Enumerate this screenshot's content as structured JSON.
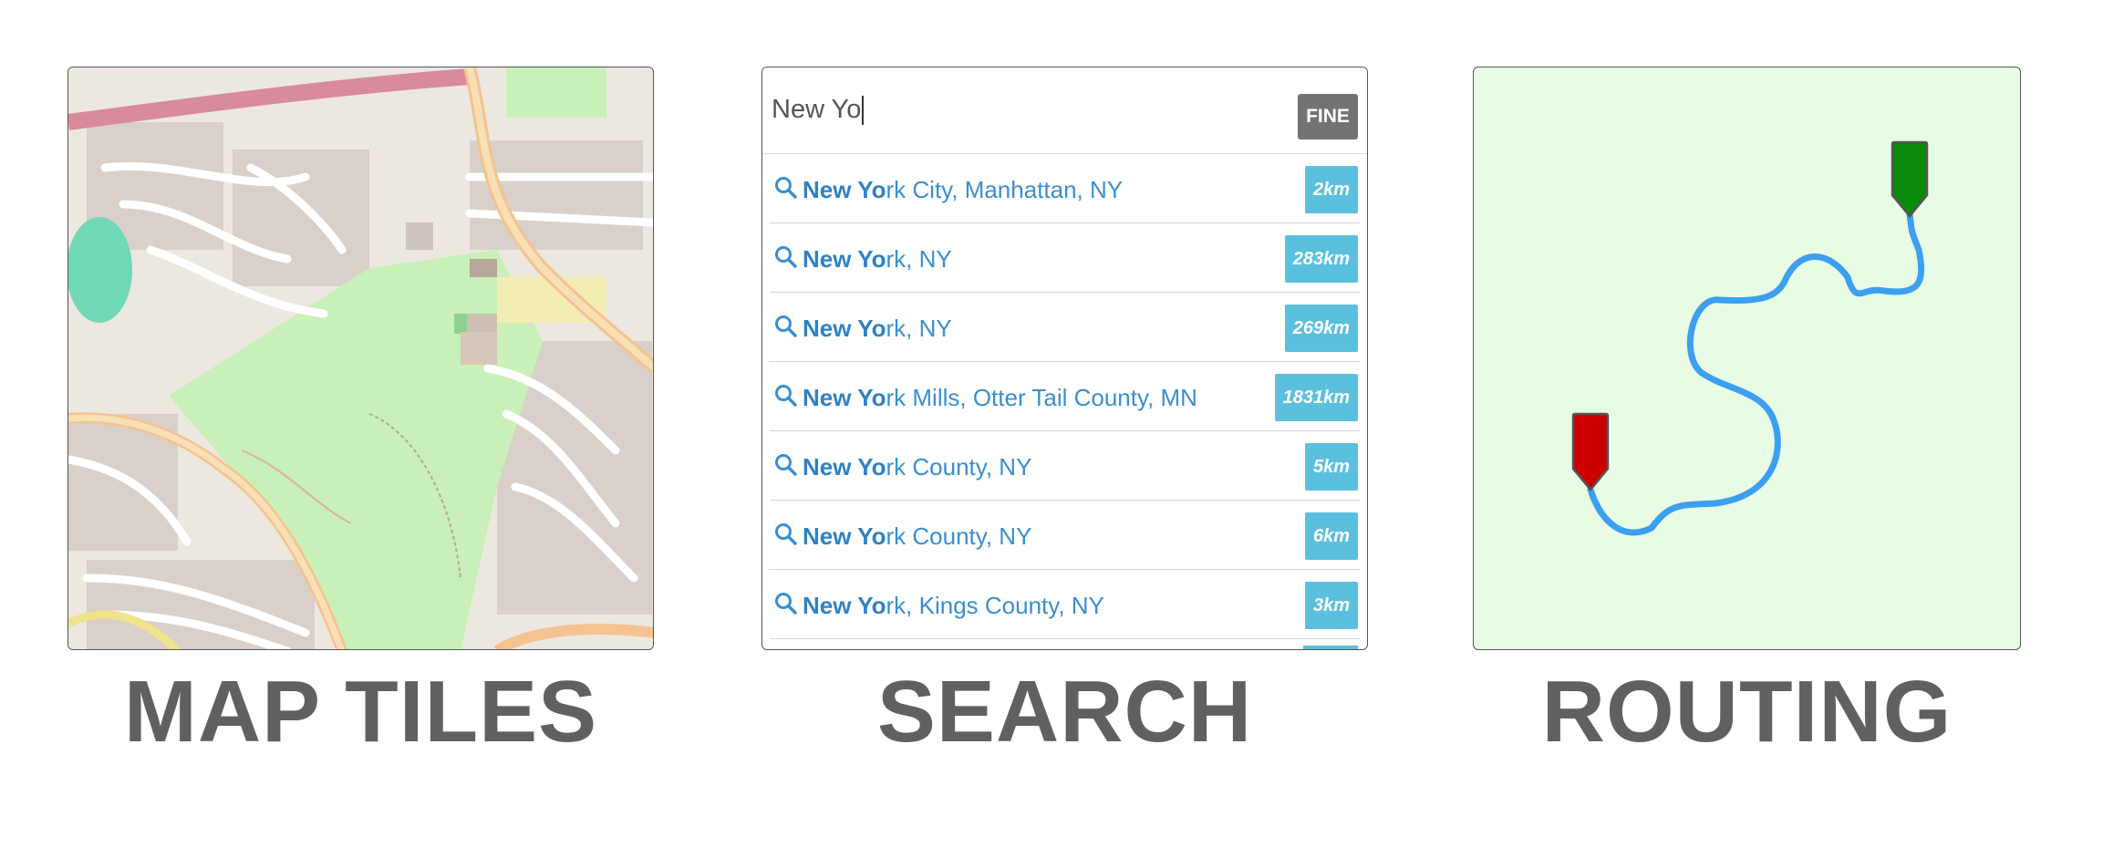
{
  "panels": {
    "map": {
      "caption": "MAP TILES"
    },
    "search": {
      "caption": "SEARCH",
      "query": "New Yo",
      "find_button": "FINE",
      "results": [
        {
          "match": "New Yo",
          "rest": "rk City, Manhattan, NY",
          "distance": "2km"
        },
        {
          "match": "New Yo",
          "rest": "rk, NY",
          "distance": "283km"
        },
        {
          "match": "New Yo",
          "rest": "rk, NY",
          "distance": "269km"
        },
        {
          "match": "New Yo",
          "rest": "rk Mills, Otter Tail County, MN",
          "distance": "1831km"
        },
        {
          "match": "New Yo",
          "rest": "rk County, NY",
          "distance": "5km"
        },
        {
          "match": "New Yo",
          "rest": "rk County, NY",
          "distance": "6km"
        },
        {
          "match": "New Yo",
          "rest": "rk, Kings County, NY",
          "distance": "3km"
        }
      ]
    },
    "routing": {
      "caption": "ROUTING"
    }
  },
  "icons": {
    "result_icon": "search-icon",
    "start_marker": "start-marker-icon",
    "end_marker": "end-marker-icon"
  },
  "colors": {
    "caption": "#606060",
    "badge": "#5bc0de",
    "link": "#3a8fd0",
    "route_line": "#3c9ff0",
    "start_marker": "#cc0000",
    "end_marker": "#0a8a0a",
    "routing_bg": "#e8fbe5"
  }
}
